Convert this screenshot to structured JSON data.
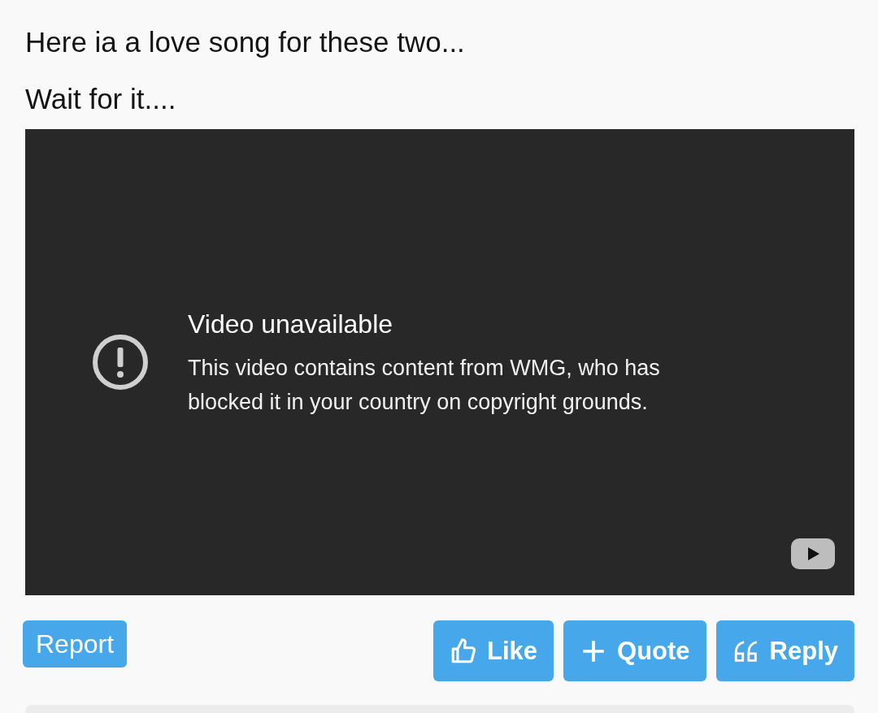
{
  "post": {
    "lines": [
      "Here ia a love song for these two...",
      "Wait for it...."
    ]
  },
  "video": {
    "title": "Video unavailable",
    "message": "This video contains content from WMG, who has blocked it in your country on copyright grounds."
  },
  "report": "Report",
  "actions": [
    {
      "kind": "like",
      "label": "Like"
    },
    {
      "kind": "quote",
      "label": "Quote"
    },
    {
      "kind": "reply",
      "label": "Reply"
    }
  ]
}
